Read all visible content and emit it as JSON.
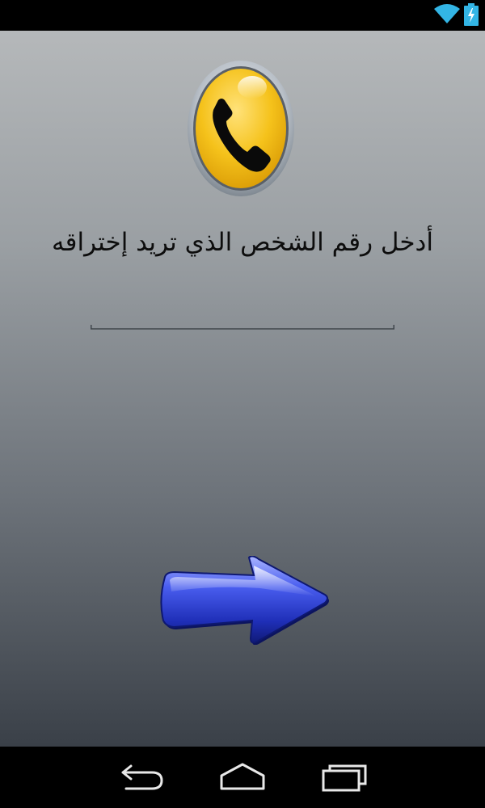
{
  "status_bar": {
    "icons": [
      "wifi-icon",
      "battery-charging-icon"
    ],
    "accent_color": "#33b5e5"
  },
  "main": {
    "logo_icon": "phone-handset-icon",
    "prompt_text": "أدخل رقم الشخص الذي تريد إختراقه",
    "phone_input": {
      "value": "",
      "placeholder": ""
    },
    "next_button_icon": "right-arrow-icon"
  },
  "nav_bar": {
    "icons": [
      "back-icon",
      "home-icon",
      "recent-apps-icon"
    ]
  },
  "colors": {
    "logo_yellow": "#f5c21b",
    "arrow_blue": "#2a3fd0"
  }
}
